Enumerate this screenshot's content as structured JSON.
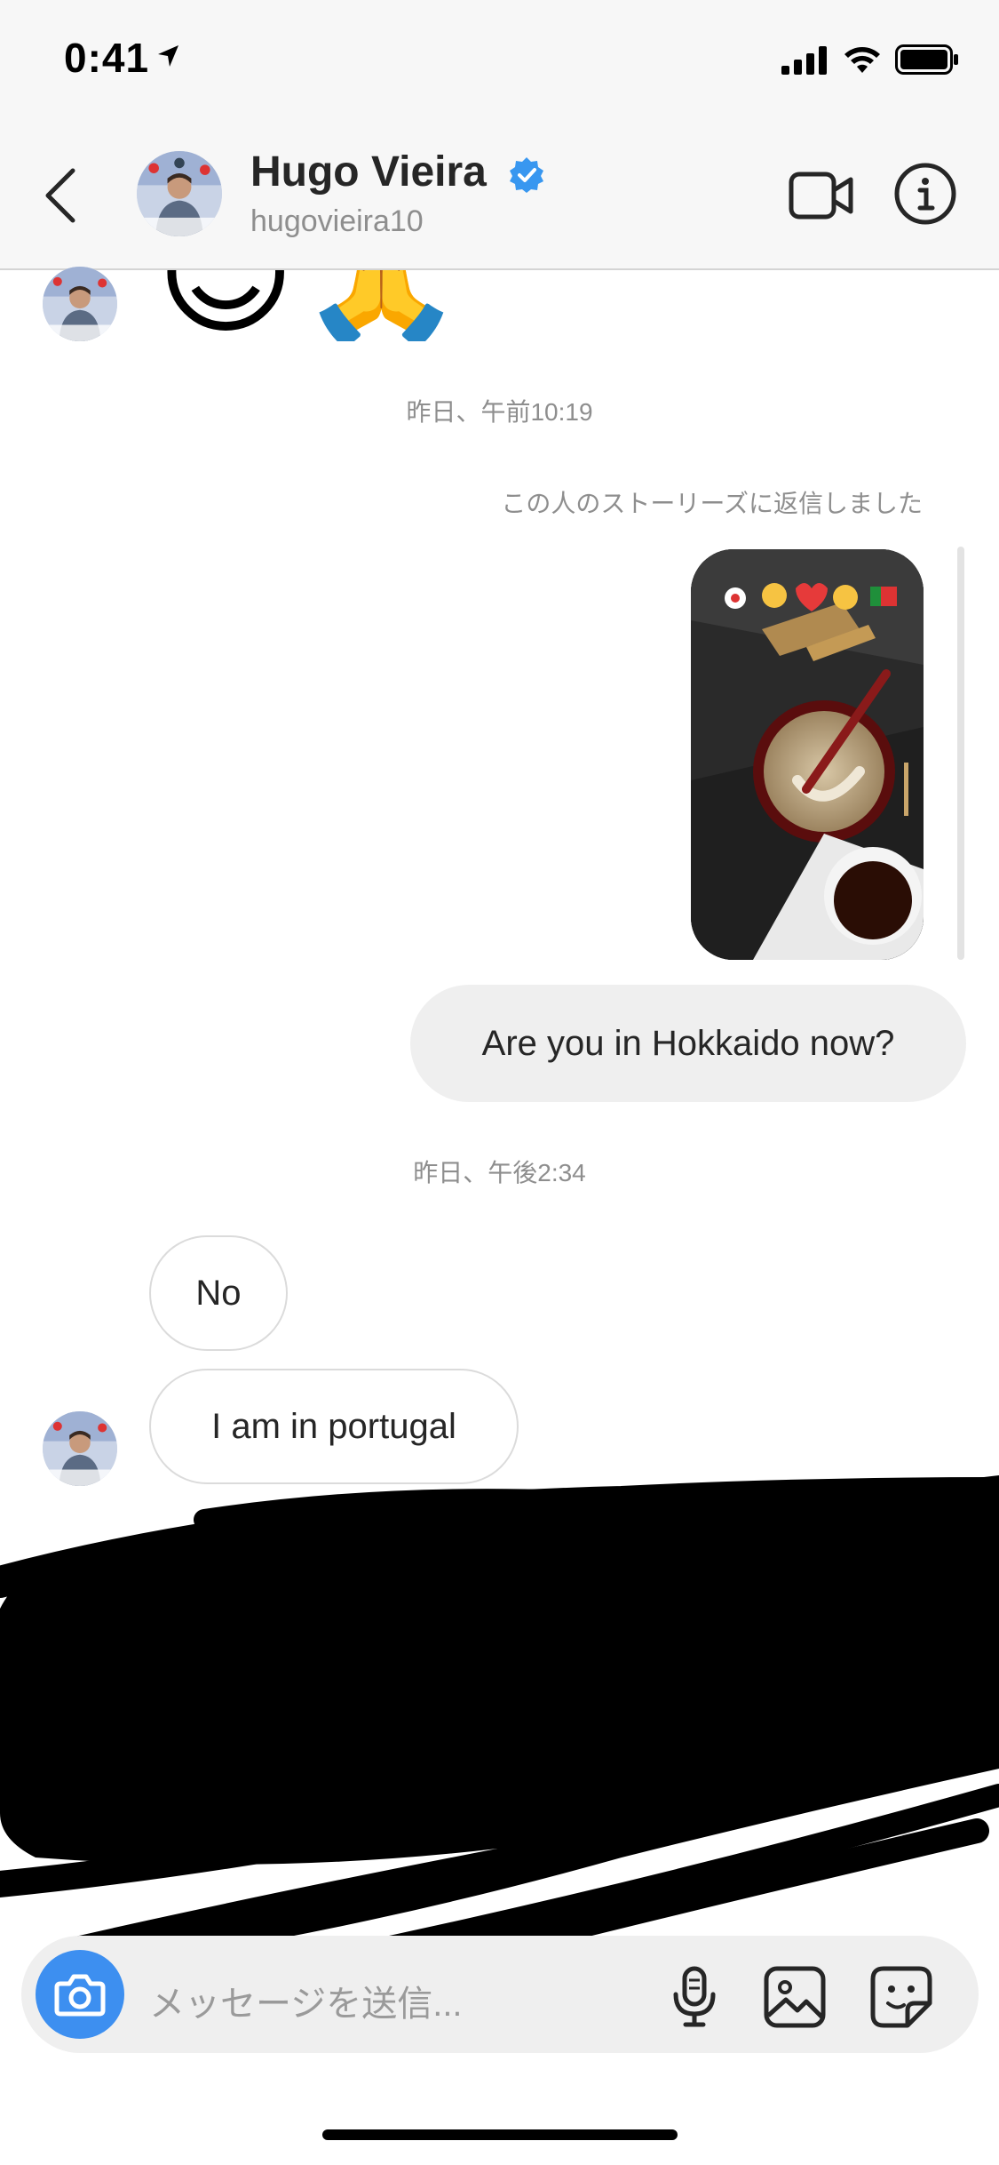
{
  "status_bar": {
    "time": "0:41"
  },
  "header": {
    "name": "Hugo Vieira",
    "handle": "hugovieira10",
    "verified": true
  },
  "messages": {
    "reaction_emojis": [
      "😊",
      "🙏"
    ],
    "timestamp_1": "昨日、午前10:19",
    "story_reply_label": "この人のストーリーズに返信しました",
    "sent_message": "Are you in Hokkaido now?",
    "timestamp_2": "昨日、午後2:34",
    "received": [
      "No",
      "I am in portugal"
    ]
  },
  "composer": {
    "placeholder": "メッセージを送信..."
  },
  "colors": {
    "verified_blue": "#3897f0",
    "camera_blue": "#3d8ff0",
    "sent_bubble": "#efefef"
  }
}
